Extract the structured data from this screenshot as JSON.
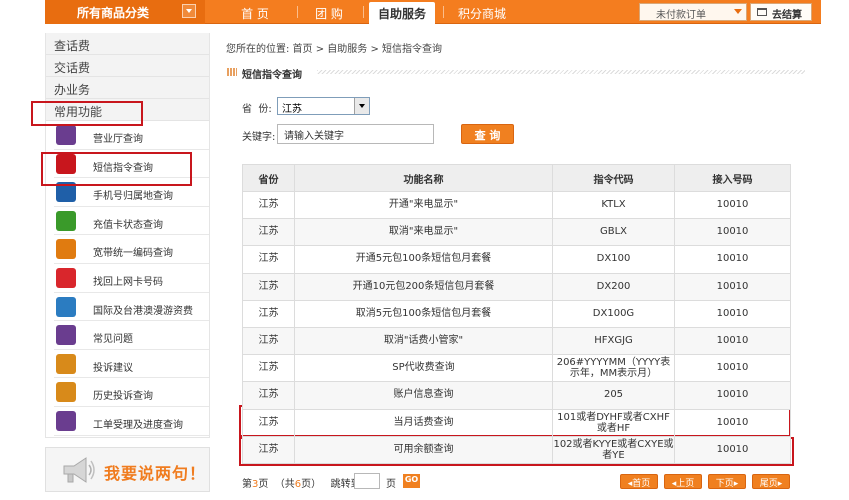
{
  "topnav": {
    "category_label": "所有商品分类",
    "items": [
      {
        "label": "首 页"
      },
      {
        "label": "团 购"
      },
      {
        "label": "自助服务"
      },
      {
        "label": "积分商城"
      }
    ],
    "order_dropdown": "未付款订单",
    "checkout": "去结算"
  },
  "sidebar": {
    "headings": [
      "查话费",
      "交话费",
      "办业务",
      "常用功能"
    ],
    "items": [
      {
        "label": "营业厅查询",
        "icon": "building-icon",
        "color": "#6a3d8f"
      },
      {
        "label": "短信指令查询",
        "icon": "sms-envelope-icon",
        "color": "#c8161d"
      },
      {
        "label": "手机号归属地查询",
        "icon": "phone-search-icon",
        "color": "#1f5fa8"
      },
      {
        "label": "充值卡状态查询",
        "icon": "card-search-icon",
        "color": "#3a9a2a"
      },
      {
        "label": "宽带统一编码查询",
        "icon": "monitor-icon",
        "color": "#e07b10"
      },
      {
        "label": "找回上网卡号码",
        "icon": "netcard-icon",
        "color": "#d9262c"
      },
      {
        "label": "国际及台港澳漫游资费",
        "icon": "globe-icon",
        "color": "#2b7cc1"
      },
      {
        "label": "常见问题",
        "icon": "question-icon",
        "color": "#6a3d8f"
      },
      {
        "label": "投诉建议",
        "icon": "complaint-icon",
        "color": "#d88a1a"
      },
      {
        "label": "历史投诉查询",
        "icon": "history-icon",
        "color": "#d88a1a"
      },
      {
        "label": "工单受理及进度查询",
        "icon": "worksheet-icon",
        "color": "#6a3d8f"
      }
    ],
    "promo": "我要说两句！"
  },
  "breadcrumb": "您所在的位置: 首页 > 自助服务 > 短信指令查询",
  "section_title": "短信指令查询",
  "form": {
    "province_label": "省  份:",
    "province_value": "江苏",
    "keyword_label": "关键字:",
    "keyword_placeholder": "请输入关键字",
    "query_button": "查 询"
  },
  "table": {
    "headers": [
      "省份",
      "功能名称",
      "指令代码",
      "接入号码"
    ],
    "rows": [
      [
        "江苏",
        "开通\"来电显示\"",
        "KTLX",
        "10010"
      ],
      [
        "江苏",
        "取消\"来电显示\"",
        "GBLX",
        "10010"
      ],
      [
        "江苏",
        "开通5元包100条短信包月套餐",
        "DX100",
        "10010"
      ],
      [
        "江苏",
        "开通10元包200条短信包月套餐",
        "DX200",
        "10010"
      ],
      [
        "江苏",
        "取消5元包100条短信包月套餐",
        "DX100G",
        "10010"
      ],
      [
        "江苏",
        "取消\"话费小管家\"",
        "HFXGJG",
        "10010"
      ],
      [
        "江苏",
        "SP代收费查询",
        "206#YYYYMM（YYYY表示年，MM表示月）",
        "10010"
      ],
      [
        "江苏",
        "账户信息查询",
        "205",
        "10010"
      ],
      [
        "江苏",
        "当月话费查询",
        "101或者DYHF或者CXHF或者HF",
        "10010"
      ],
      [
        "江苏",
        "可用余额查询",
        "102或者KYYE或者CXYE或者YE",
        "10010"
      ]
    ]
  },
  "pager": {
    "current_prefix": "第",
    "current": "3",
    "current_suffix": "页",
    "total_prefix": "（共",
    "total": "6",
    "total_suffix": "页）",
    "goto_label": "跳转到",
    "page_label": "页",
    "go": "GO",
    "first": "首页",
    "prev": "上页",
    "next": "下页",
    "last": "尾页"
  },
  "colors": {
    "brand_orange": "#f47d1f",
    "highlight_red": "#c8161d"
  }
}
